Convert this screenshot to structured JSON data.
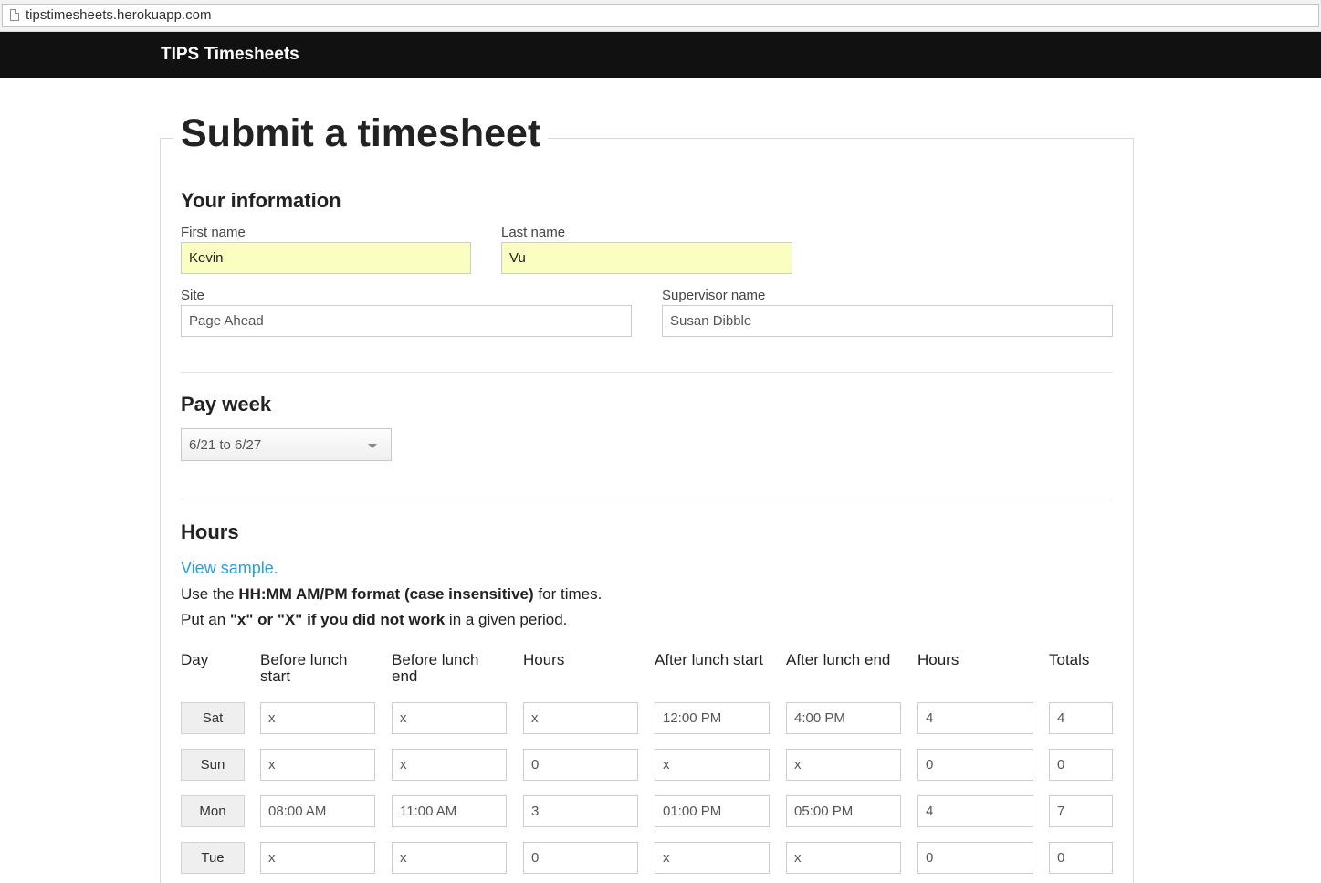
{
  "browser": {
    "url": "tipstimesheets.herokuapp.com"
  },
  "navbar": {
    "brand": "TIPS Timesheets"
  },
  "page": {
    "title": "Submit a timesheet"
  },
  "your_information": {
    "heading": "Your information",
    "first_name": {
      "label": "First name",
      "value": "Kevin"
    },
    "last_name": {
      "label": "Last name",
      "value": "Vu"
    },
    "site": {
      "label": "Site",
      "value": "Page Ahead"
    },
    "supervisor": {
      "label": "Supervisor name",
      "value": "Susan Dibble"
    }
  },
  "pay_week": {
    "heading": "Pay week",
    "selected": "6/21 to 6/27"
  },
  "hours": {
    "heading": "Hours",
    "sample_link": "View sample.",
    "help1": {
      "prefix": "Use the ",
      "bold": "HH:MM AM/PM format (case insensitive)",
      "suffix": " for times."
    },
    "help2": {
      "prefix": "Put an ",
      "bold": "\"x\" or \"X\" if you did not work",
      "suffix": " in a given period."
    },
    "columns": [
      "Day",
      "Before lunch start",
      "Before lunch end",
      "Hours",
      "After lunch start",
      "After lunch end",
      "Hours",
      "Totals"
    ],
    "rows": [
      {
        "day": "Sat",
        "values": [
          "x",
          "x",
          "x",
          "12:00 PM",
          "4:00 PM",
          "4",
          "4"
        ]
      },
      {
        "day": "Sun",
        "values": [
          "x",
          "x",
          "0",
          "x",
          "x",
          "0",
          "0"
        ]
      },
      {
        "day": "Mon",
        "values": [
          "08:00 AM",
          "11:00 AM",
          "3",
          "01:00 PM",
          "05:00 PM",
          "4",
          "7"
        ]
      },
      {
        "day": "Tue",
        "values": [
          "x",
          "x",
          "0",
          "x",
          "x",
          "0",
          "0"
        ]
      }
    ]
  }
}
